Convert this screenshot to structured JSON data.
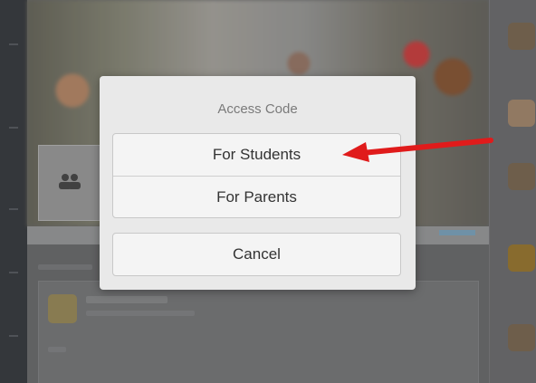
{
  "dialog": {
    "title": "Access Code",
    "options": [
      {
        "label": "For Students"
      },
      {
        "label": "For Parents"
      }
    ],
    "cancel_label": "Cancel"
  },
  "annotation": {
    "color": "#e01b1b",
    "points_to": "For Students"
  },
  "colors": {
    "dialog_bg": "#e9e9e9",
    "option_bg": "#f4f4f4",
    "text": "#333333",
    "title_text": "#7a7a7a"
  },
  "icons": {
    "group_tile": "people-icon"
  }
}
